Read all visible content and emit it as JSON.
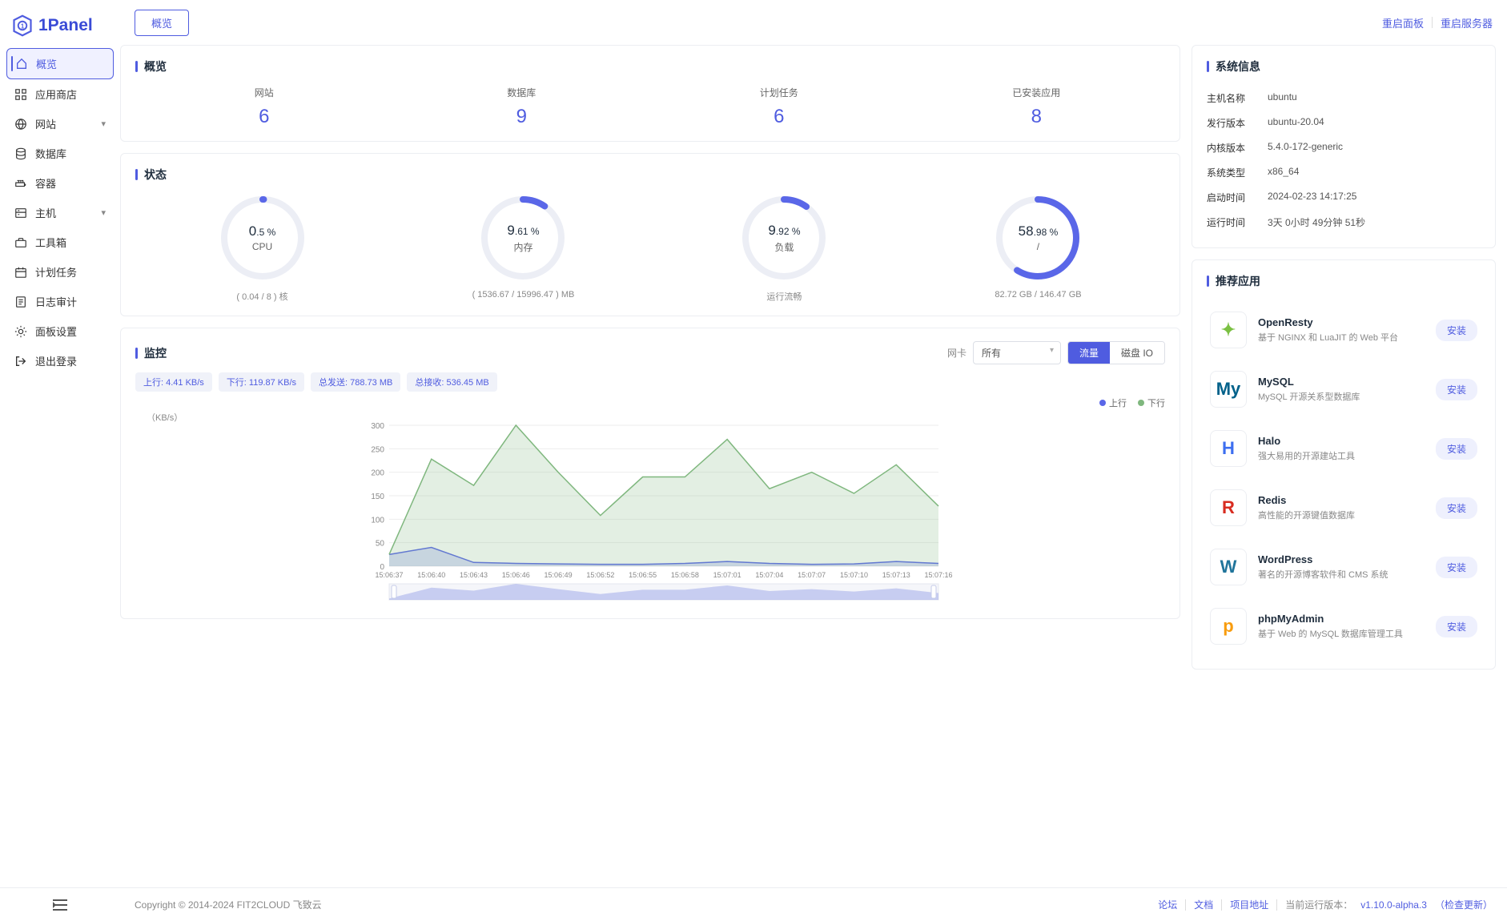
{
  "logo_text": "1Panel",
  "sidebar": {
    "items": [
      {
        "icon": "home",
        "label": "概览",
        "active": true
      },
      {
        "icon": "apps",
        "label": "应用商店"
      },
      {
        "icon": "globe",
        "label": "网站",
        "expandable": true
      },
      {
        "icon": "database",
        "label": "数据库"
      },
      {
        "icon": "container",
        "label": "容器"
      },
      {
        "icon": "host",
        "label": "主机",
        "expandable": true
      },
      {
        "icon": "toolbox",
        "label": "工具箱"
      },
      {
        "icon": "schedule",
        "label": "计划任务"
      },
      {
        "icon": "audit",
        "label": "日志审计"
      },
      {
        "icon": "settings",
        "label": "面板设置"
      },
      {
        "icon": "logout",
        "label": "退出登录"
      }
    ]
  },
  "header": {
    "tab": "概览",
    "restart_panel": "重启面板",
    "restart_server": "重启服务器"
  },
  "overview": {
    "title": "概览",
    "items": [
      {
        "label": "网站",
        "value": "6"
      },
      {
        "label": "数据库",
        "value": "9"
      },
      {
        "label": "计划任务",
        "value": "6"
      },
      {
        "label": "已安装应用",
        "value": "8"
      }
    ]
  },
  "status": {
    "title": "状态",
    "gauges": [
      {
        "int": "0",
        "dec": ".5 %",
        "name": "CPU",
        "sub": "( 0.04 / 8 ) 核",
        "pct": 0.5
      },
      {
        "int": "9",
        "dec": ".61 %",
        "name": "内存",
        "sub": "( 1536.67 / 15996.47 ) MB",
        "pct": 9.61
      },
      {
        "int": "9",
        "dec": ".92 %",
        "name": "负载",
        "sub": "运行流畅",
        "pct": 9.92
      },
      {
        "int": "58",
        "dec": ".98 %",
        "name": "/",
        "sub": "82.72 GB / 146.47 GB",
        "pct": 58.98
      }
    ]
  },
  "monitor": {
    "title": "监控",
    "net_label": "网卡",
    "net_select": "所有",
    "seg_traffic": "流量",
    "seg_diskio": "磁盘 IO",
    "tags": [
      "上行: 4.41 KB/s",
      "下行: 119.87 KB/s",
      "总发送: 788.73 MB",
      "总接收: 536.45 MB"
    ],
    "legend_up": "上行",
    "legend_down": "下行",
    "y_unit": "（KB/s）"
  },
  "sysinfo": {
    "title": "系统信息",
    "rows": [
      {
        "key": "主机名称",
        "val": "ubuntu"
      },
      {
        "key": "发行版本",
        "val": "ubuntu-20.04"
      },
      {
        "key": "内核版本",
        "val": "5.4.0-172-generic"
      },
      {
        "key": "系统类型",
        "val": "x86_64"
      },
      {
        "key": "启动时间",
        "val": "2024-02-23 14:17:25"
      },
      {
        "key": "运行时间",
        "val": "3天 0小时 49分钟 51秒"
      }
    ]
  },
  "recommend": {
    "title": "推荐应用",
    "install_label": "安装",
    "apps": [
      {
        "name": "OpenResty",
        "desc": "基于 NGINX 和 LuaJIT 的 Web 平台",
        "color": "#7bc043",
        "glyph": "✦"
      },
      {
        "name": "MySQL",
        "desc": "MySQL 开源关系型数据库",
        "color": "#00618a",
        "glyph": "My"
      },
      {
        "name": "Halo",
        "desc": "强大易用的开源建站工具",
        "color": "#3c6ef0",
        "glyph": "H"
      },
      {
        "name": "Redis",
        "desc": "高性能的开源键值数据库",
        "color": "#d82c20",
        "glyph": "R"
      },
      {
        "name": "WordPress",
        "desc": "著名的开源博客软件和 CMS 系统",
        "color": "#21759b",
        "glyph": "W"
      },
      {
        "name": "phpMyAdmin",
        "desc": "基于 Web 的 MySQL 数据库管理工具",
        "color": "#f89c0e",
        "glyph": "p"
      }
    ]
  },
  "footer": {
    "copyright": "Copyright © 2014-2024 FIT2CLOUD 飞致云",
    "forum": "论坛",
    "docs": "文档",
    "project": "项目地址",
    "version_label": "当前运行版本：",
    "version": "v1.10.0-alpha.3",
    "check_update": "（检查更新）"
  },
  "chart_data": {
    "type": "area",
    "y_unit": "KB/s",
    "ylim": [
      0,
      300
    ],
    "y_ticks": [
      0,
      50,
      100,
      150,
      200,
      250,
      300
    ],
    "x_labels": [
      "15:06:37",
      "15:06:40",
      "15:06:43",
      "15:06:46",
      "15:06:49",
      "15:06:52",
      "15:06:55",
      "15:06:58",
      "15:07:01",
      "15:07:04",
      "15:07:07",
      "15:07:10",
      "15:07:13",
      "15:07:16"
    ],
    "series": [
      {
        "name": "上行",
        "color": "#5a67e8",
        "values": [
          25,
          40,
          8,
          6,
          5,
          4,
          4,
          6,
          10,
          6,
          4,
          5,
          10,
          6
        ]
      },
      {
        "name": "下行",
        "color": "#7fb77e",
        "values": [
          25,
          228,
          172,
          300,
          200,
          108,
          190,
          190,
          270,
          165,
          200,
          155,
          216,
          128
        ]
      }
    ]
  }
}
